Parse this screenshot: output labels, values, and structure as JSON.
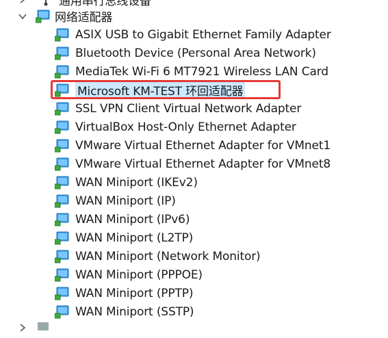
{
  "category": {
    "label": "网络适配器",
    "icon": "network-adapter-category-icon",
    "expanded": true
  },
  "previous_category": {
    "label": "通用串行总线设备",
    "icon": "usb-device-category-icon"
  },
  "devices": [
    {
      "label": "ASIX USB to Gigabit Ethernet Family Adapter",
      "icon": "network-adapter-icon"
    },
    {
      "label": "Bluetooth Device (Personal Area Network)",
      "icon": "network-adapter-icon"
    },
    {
      "label": "MediaTek Wi-Fi 6 MT7921 Wireless LAN Card",
      "icon": "network-adapter-icon"
    },
    {
      "label": "Microsoft KM-TEST 环回适配器",
      "icon": "network-adapter-icon",
      "selected": true,
      "highlighted": true
    },
    {
      "label": "SSL VPN Client Virtual Network Adapter",
      "icon": "network-adapter-icon"
    },
    {
      "label": "VirtualBox Host-Only Ethernet Adapter",
      "icon": "network-adapter-icon"
    },
    {
      "label": "VMware Virtual Ethernet Adapter for VMnet1",
      "icon": "network-adapter-icon"
    },
    {
      "label": "VMware Virtual Ethernet Adapter for VMnet8",
      "icon": "network-adapter-icon"
    },
    {
      "label": "WAN Miniport (IKEv2)",
      "icon": "network-adapter-icon"
    },
    {
      "label": "WAN Miniport (IP)",
      "icon": "network-adapter-icon"
    },
    {
      "label": "WAN Miniport (IPv6)",
      "icon": "network-adapter-icon"
    },
    {
      "label": "WAN Miniport (L2TP)",
      "icon": "network-adapter-icon"
    },
    {
      "label": "WAN Miniport (Network Monitor)",
      "icon": "network-adapter-icon"
    },
    {
      "label": "WAN Miniport (PPPOE)",
      "icon": "network-adapter-icon"
    },
    {
      "label": "WAN Miniport (PPTP)",
      "icon": "network-adapter-icon"
    },
    {
      "label": "WAN Miniport (SSTP)",
      "icon": "network-adapter-icon"
    }
  ],
  "colors": {
    "selection": "#cce8ff",
    "highlight_border": "#e53935",
    "monitor_blue": "#3aa0e8",
    "cable_green": "#3cab3c"
  }
}
